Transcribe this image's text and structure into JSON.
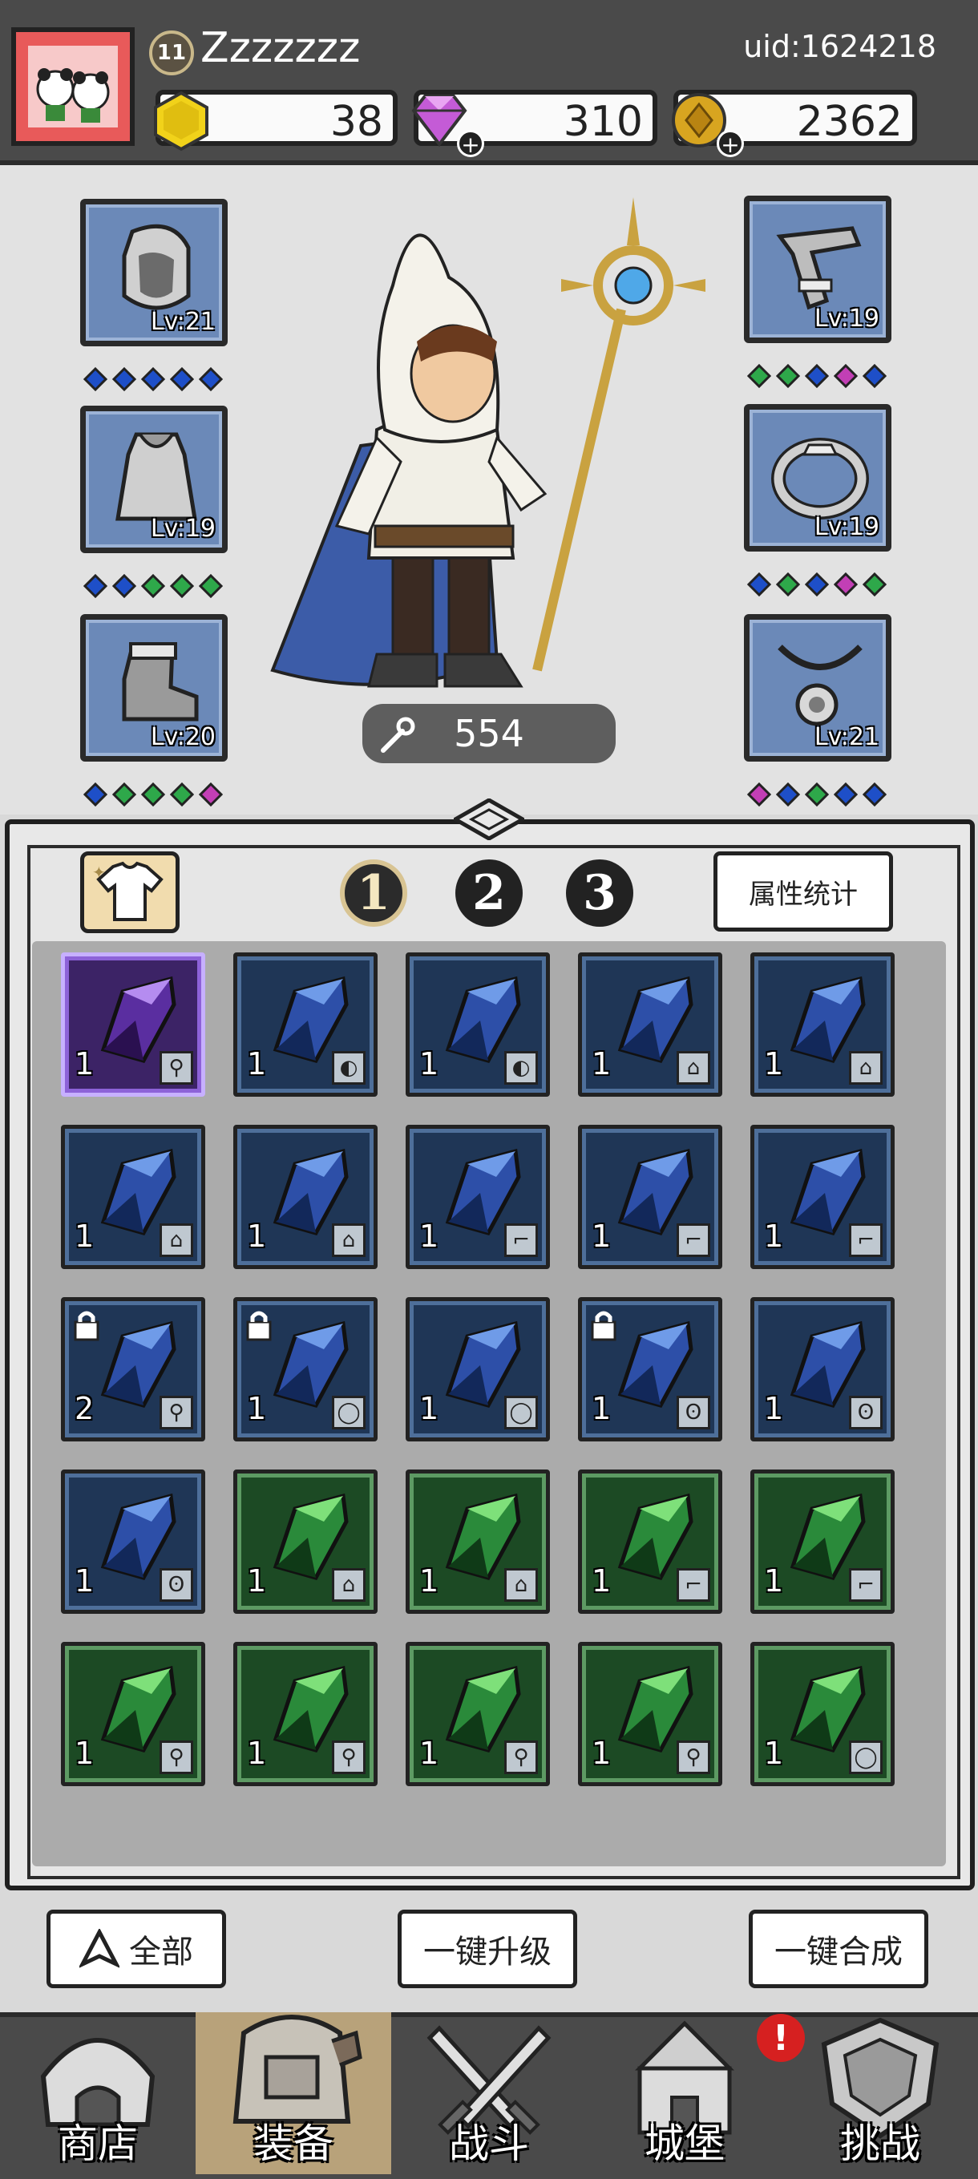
{
  "player": {
    "level": "11",
    "name": "Zzzzzzz",
    "uid": "uid:1624218"
  },
  "currencies": {
    "gold_block": "38",
    "gems": "310",
    "coins": "2362"
  },
  "equipment_left": [
    {
      "label": "Lv:21",
      "icon": "hood-icon",
      "gems": [
        "#1e4fc8",
        "#1e4fc8",
        "#1e4fc8",
        "#1e4fc8",
        "#1e4fc8"
      ]
    },
    {
      "label": "Lv:19",
      "icon": "cape-icon",
      "gems": [
        "#1e4fc8",
        "#1e4fc8",
        "#2ea84a",
        "#2ea84a",
        "#2ea84a"
      ]
    },
    {
      "label": "Lv:20",
      "icon": "boot-icon",
      "gems": [
        "#1e4fc8",
        "#2ea84a",
        "#2ea84a",
        "#2ea84a",
        "#c23fb5"
      ]
    }
  ],
  "equipment_right": [
    {
      "label": "Lv:19",
      "icon": "bracer-icon",
      "gems": [
        "#2ea84a",
        "#2ea84a",
        "#1e4fc8",
        "#c23fb5",
        "#1e4fc8"
      ]
    },
    {
      "label": "Lv:19",
      "icon": "ring-icon",
      "gems": [
        "#1e4fc8",
        "#2ea84a",
        "#1e4fc8",
        "#c23fb5",
        "#2ea84a"
      ]
    },
    {
      "label": "Lv:21",
      "icon": "necklace-icon",
      "gems": [
        "#c23fb5",
        "#1e4fc8",
        "#2ea84a",
        "#1e4fc8",
        "#1e4fc8"
      ]
    }
  ],
  "power": "554",
  "pages": [
    "1",
    "2",
    "3"
  ],
  "stats_button": "属性统计",
  "inventory": [
    {
      "type": "purple",
      "count": "1",
      "tag": "staff",
      "locked": false
    },
    {
      "type": "blue",
      "count": "1",
      "tag": "hood",
      "locked": false
    },
    {
      "type": "blue",
      "count": "1",
      "tag": "hood",
      "locked": false
    },
    {
      "type": "blue",
      "count": "1",
      "tag": "cape",
      "locked": false
    },
    {
      "type": "blue",
      "count": "1",
      "tag": "cape",
      "locked": false
    },
    {
      "type": "blue",
      "count": "1",
      "tag": "cape",
      "locked": false
    },
    {
      "type": "blue",
      "count": "1",
      "tag": "cape",
      "locked": false
    },
    {
      "type": "blue",
      "count": "1",
      "tag": "boot",
      "locked": false
    },
    {
      "type": "blue",
      "count": "1",
      "tag": "boot",
      "locked": false
    },
    {
      "type": "blue",
      "count": "1",
      "tag": "boot",
      "locked": false
    },
    {
      "type": "blue",
      "count": "2",
      "tag": "staff",
      "locked": true
    },
    {
      "type": "blue",
      "count": "1",
      "tag": "ring",
      "locked": true
    },
    {
      "type": "blue",
      "count": "1",
      "tag": "ring",
      "locked": false
    },
    {
      "type": "blue",
      "count": "1",
      "tag": "necklace",
      "locked": true
    },
    {
      "type": "blue",
      "count": "1",
      "tag": "necklace",
      "locked": false
    },
    {
      "type": "blue",
      "count": "1",
      "tag": "necklace",
      "locked": false
    },
    {
      "type": "green",
      "count": "1",
      "tag": "cape",
      "locked": false
    },
    {
      "type": "green",
      "count": "1",
      "tag": "cape",
      "locked": false
    },
    {
      "type": "green",
      "count": "1",
      "tag": "boot",
      "locked": false
    },
    {
      "type": "green",
      "count": "1",
      "tag": "boot",
      "locked": false
    },
    {
      "type": "green",
      "count": "1",
      "tag": "staff",
      "locked": false
    },
    {
      "type": "green",
      "count": "1",
      "tag": "staff",
      "locked": false
    },
    {
      "type": "green",
      "count": "1",
      "tag": "staff",
      "locked": false
    },
    {
      "type": "green",
      "count": "1",
      "tag": "staff",
      "locked": false
    },
    {
      "type": "green",
      "count": "1",
      "tag": "ring",
      "locked": false
    }
  ],
  "actions": {
    "filter": "全部",
    "upgrade_all": "一键升级",
    "merge_all": "一键合成"
  },
  "nav": [
    {
      "label": "商店",
      "icon": "shop-icon"
    },
    {
      "label": "装备",
      "icon": "backpack-icon"
    },
    {
      "label": "战斗",
      "icon": "swords-icon"
    },
    {
      "label": "城堡",
      "icon": "castle-icon"
    },
    {
      "label": "挑战",
      "icon": "shield-icon"
    }
  ],
  "nav_alert": "!",
  "colors": {
    "blue_gem": "#1e4fc8",
    "green_gem": "#2ea84a",
    "pink_gem": "#c23fb5",
    "rare_blue": "#3b63c9",
    "uncommon_green": "#3fb04a",
    "epic_purple": "#7a3ed0"
  }
}
